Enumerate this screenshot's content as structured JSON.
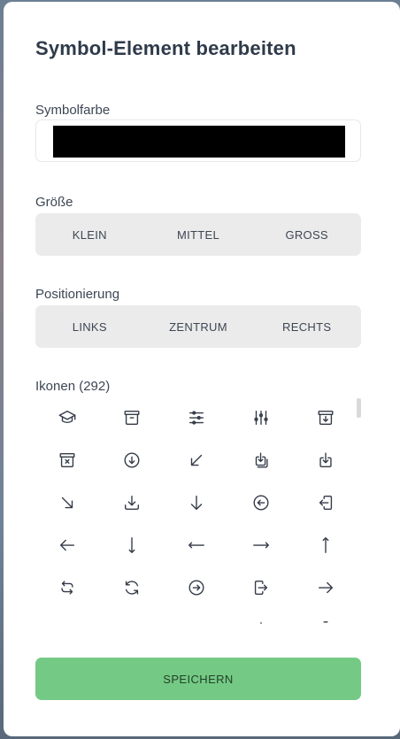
{
  "dialog": {
    "title": "Symbol-Element bearbeiten"
  },
  "color": {
    "label": "Symbolfarbe",
    "value": "#000000"
  },
  "size": {
    "label": "Größe",
    "options": [
      "KLEIN",
      "MITTEL",
      "GROSS"
    ]
  },
  "position": {
    "label": "Positionierung",
    "options": [
      "LINKS",
      "ZENTRUM",
      "RECHTS"
    ]
  },
  "icons": {
    "label": "Ikonen (292)",
    "items": [
      "graduation-cap-icon",
      "archive-box-icon",
      "adjustments-horizontal-icon",
      "adjustments-vertical-icon",
      "archive-box-arrow-down-icon",
      "archive-box-x-mark-icon",
      "arrow-down-circle-icon",
      "arrow-down-left-icon",
      "arrow-down-on-square-stack-icon",
      "arrow-down-on-square-icon",
      "arrow-down-right-icon",
      "arrow-down-tray-icon",
      "arrow-down-icon",
      "arrow-left-circle-icon",
      "arrow-left-on-rectangle-icon",
      "arrow-left-icon",
      "arrow-long-down-icon",
      "arrow-long-left-icon",
      "arrow-long-right-icon",
      "arrow-long-up-icon",
      "arrow-path-rounded-square-icon",
      "arrow-path-icon",
      "arrow-right-circle-icon",
      "arrow-right-on-rectangle-icon",
      "arrow-right-icon"
    ]
  },
  "actions": {
    "save_label": "SPEICHERN"
  },
  "colors": {
    "save_button": "#74ca84",
    "segment_bg": "#ebebeb",
    "title_text": "#2f3a4a"
  }
}
